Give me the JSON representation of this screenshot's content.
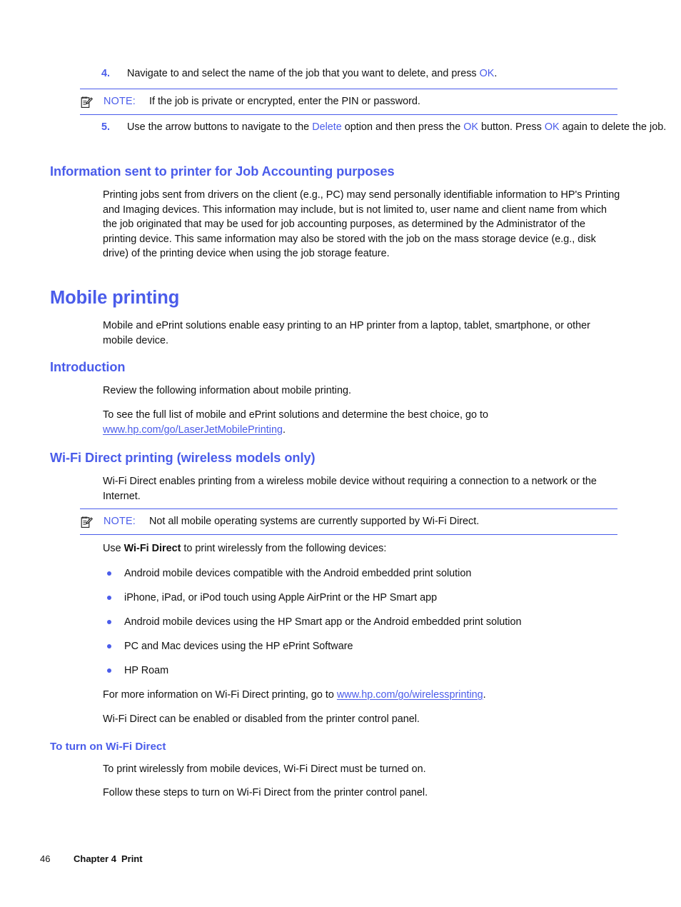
{
  "document": {
    "steps": [
      {
        "number": "4.",
        "text_before": "Navigate to and select the name of the job that you want to delete, and press ",
        "emphasis": "OK",
        "text_after": "."
      }
    ],
    "note1": {
      "icon": "note-pad-pencil-icon",
      "label": "NOTE:",
      "body": "If the job is private or encrypted, enter the PIN or password."
    },
    "step5": {
      "number": "5.",
      "part1": "Use the arrow buttons to navigate to the ",
      "link1": "Delete",
      "part2": " option and then press the ",
      "link2": "OK",
      "part3": " button. Press ",
      "link3": "OK",
      "part4": " again to delete the job."
    },
    "section_job_accounting": {
      "heading": "Information sent to printer for Job Accounting purposes",
      "paragraph": "Printing jobs sent from drivers on the client (e.g., PC) may send personally identifiable information to HP's Printing and Imaging devices. This information may include, but is not limited to, user name and client name from which the job originated that may be used for job accounting purposes, as determined by the Administrator of the printing device. This same information may also be stored with the job on the mass storage device (e.g., disk drive) of the printing device when using the job storage feature."
    },
    "section_mobile_printing": {
      "heading": "Mobile printing",
      "paragraph": "Mobile and ePrint solutions enable easy printing to an HP printer from a laptop, tablet, smartphone, or other mobile device."
    },
    "section_introduction": {
      "heading": "Introduction",
      "paragraph1": "Review the following information about mobile printing.",
      "paragraph2_before": "To see the full list of mobile and ePrint solutions and determine the best choice, go to ",
      "link": "www.hp.com/go/LaserJetMobilePrinting",
      "paragraph2_after": "."
    },
    "section_wifi_direct": {
      "heading": "Wi-Fi Direct printing (wireless models only)",
      "paragraph": "Wi-Fi Direct enables printing from a wireless mobile device without requiring a connection to a network or the Internet.",
      "note": {
        "icon": "note-pad-pencil-icon",
        "label": "NOTE:",
        "body": "Not all mobile operating systems are currently supported by Wi-Fi Direct."
      },
      "use_line_before": "Use ",
      "use_line_bold": "Wi-Fi Direct",
      "use_line_after": " to print wirelessly from the following devices:",
      "bullets": [
        "Android mobile devices compatible with the Android embedded print solution",
        "iPhone, iPad, or iPod touch using Apple AirPrint or the HP Smart app",
        "Android mobile devices using the HP Smart app or the Android embedded print solution",
        "PC and Mac devices using the HP ePrint Software",
        "HP Roam"
      ],
      "more_info_before": "For more information on Wi-Fi Direct printing, go to ",
      "more_info_link": "www.hp.com/go/wirelessprinting",
      "more_info_after": ".",
      "enable_line": "Wi-Fi Direct can be enabled or disabled from the printer control panel."
    },
    "section_turn_on": {
      "heading": "To turn on Wi-Fi Direct",
      "paragraph1": "To print wirelessly from mobile devices, Wi-Fi Direct must be turned on.",
      "paragraph2": "Follow these steps to turn on Wi-Fi Direct from the printer control panel."
    },
    "footer": {
      "page_number": "46",
      "chapter": "Chapter 4",
      "chapter_title": "Print"
    },
    "colors": {
      "accent_blue": "#4a5cea",
      "body_text": "#111111",
      "background": "#ffffff"
    }
  }
}
